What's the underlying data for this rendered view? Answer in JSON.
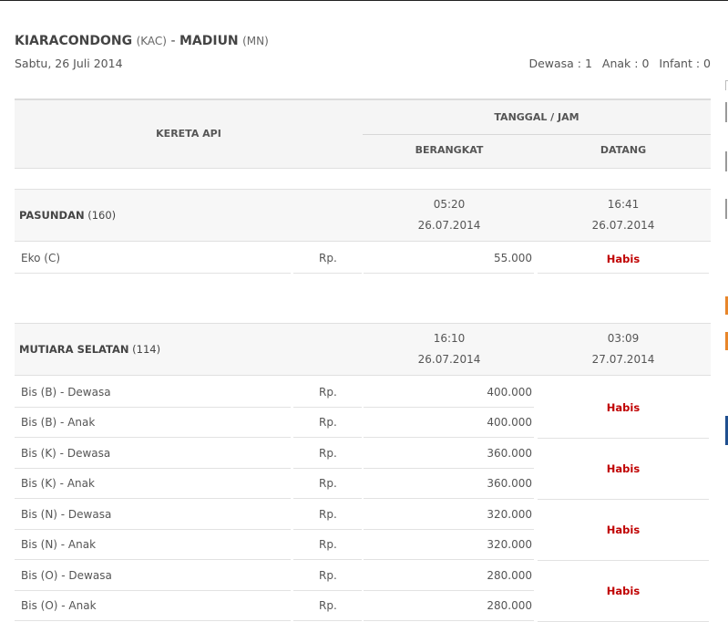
{
  "route": {
    "origin": "KIARACONDONG",
    "origin_code": "(KAC)",
    "separator": "-",
    "destination": "MADIUN",
    "destination_code": "(MN)"
  },
  "date": "Sabtu, 26 Juli 2014",
  "passengers": {
    "adult": "Dewasa : 1",
    "child": "Anak : 0",
    "infant": "Infant : 0"
  },
  "table": {
    "col_train": "KERETA API",
    "col_datetime": "TANGGAL / JAM",
    "col_depart": "BERANGKAT",
    "col_arrive": "DATANG"
  },
  "trains": [
    {
      "name": "PASUNDAN",
      "number": "(160)",
      "depart_time": "05:20",
      "depart_date": "26.07.2014",
      "arrive_time": "16:41",
      "arrive_date": "26.07.2014",
      "fares": [
        {
          "class": "Eko (C)",
          "currency": "Rp.",
          "amount": "55.000"
        }
      ],
      "status": [
        "Habis"
      ]
    },
    {
      "name": "MUTIARA SELATAN",
      "number": "(114)",
      "depart_time": "16:10",
      "depart_date": "26.07.2014",
      "arrive_time": "03:09",
      "arrive_date": "27.07.2014",
      "fares": [
        {
          "class": "Bis (B) - Dewasa",
          "currency": "Rp.",
          "amount": "400.000"
        },
        {
          "class": "Bis (B) - Anak",
          "currency": "Rp.",
          "amount": "400.000"
        },
        {
          "class": "Bis (K) - Dewasa",
          "currency": "Rp.",
          "amount": "360.000"
        },
        {
          "class": "Bis (K) - Anak",
          "currency": "Rp.",
          "amount": "360.000"
        },
        {
          "class": "Bis (N) - Dewasa",
          "currency": "Rp.",
          "amount": "320.000"
        },
        {
          "class": "Bis (N) - Anak",
          "currency": "Rp.",
          "amount": "320.000"
        },
        {
          "class": "Bis (O) - Dewasa",
          "currency": "Rp.",
          "amount": "280.000"
        },
        {
          "class": "Bis (O) - Anak",
          "currency": "Rp.",
          "amount": "280.000"
        }
      ],
      "status": [
        "Habis",
        "Habis",
        "Habis",
        "Habis"
      ]
    }
  ],
  "colors": {
    "sold_out": "#c00000",
    "header_bg": "#f5f5f5",
    "edge_orange": "#e8862a",
    "edge_blue": "#1f4f8f"
  }
}
